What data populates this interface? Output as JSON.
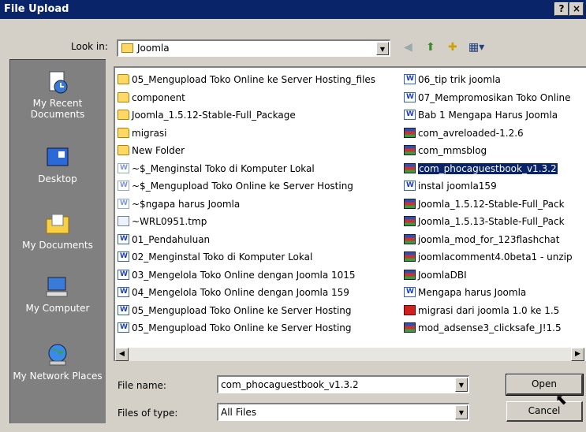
{
  "window": {
    "title": "File Upload",
    "help": "?",
    "close": "×"
  },
  "lookin": {
    "label": "Look in:",
    "value": "Joomla"
  },
  "toolbar": {
    "back": "back-icon",
    "up": "up-folder-icon",
    "new_folder": "new-folder-icon",
    "views": "views-menu-icon"
  },
  "places": [
    {
      "label": "My Recent Documents",
      "icon": "recent-documents-icon"
    },
    {
      "label": "Desktop",
      "icon": "desktop-icon"
    },
    {
      "label": "My Documents",
      "icon": "my-documents-icon"
    },
    {
      "label": "My Computer",
      "icon": "my-computer-icon"
    },
    {
      "label": "My Network Places",
      "icon": "network-places-icon"
    }
  ],
  "files_col1": [
    {
      "name": "05_Mengupload Toko Online ke Server Hosting_files",
      "type": "folder"
    },
    {
      "name": "component",
      "type": "folder"
    },
    {
      "name": "Joomla_1.5.12-Stable-Full_Package",
      "type": "folder"
    },
    {
      "name": "migrasi",
      "type": "folder"
    },
    {
      "name": "New Folder",
      "type": "folder"
    },
    {
      "name": "~$_Menginstal Toko di Komputer Lokal",
      "type": "doc-faded"
    },
    {
      "name": "~$_Mengupload Toko Online ke Server Hosting",
      "type": "doc-faded"
    },
    {
      "name": "~$ngapa harus Joomla",
      "type": "doc-faded"
    },
    {
      "name": "~WRL0951.tmp",
      "type": "tmp"
    },
    {
      "name": "01_Pendahuluan",
      "type": "doc"
    },
    {
      "name": "02_Menginstal Toko di Komputer Lokal",
      "type": "doc"
    },
    {
      "name": "03_Mengelola Toko Online dengan Joomla 1015",
      "type": "doc"
    },
    {
      "name": "04_Mengelola Toko Online dengan Joomla 159",
      "type": "doc"
    },
    {
      "name": "05_Mengupload Toko Online ke Server Hosting",
      "type": "doc"
    },
    {
      "name": "05_Mengupload Toko Online ke Server Hosting",
      "type": "doc"
    }
  ],
  "files_col2": [
    {
      "name": "06_tip trik joomla",
      "type": "doc"
    },
    {
      "name": "07_Mempromosikan Toko Online",
      "type": "doc"
    },
    {
      "name": "Bab 1 Mengapa Harus Joomla",
      "type": "doc"
    },
    {
      "name": "com_avreloaded-1.2.6",
      "type": "rar"
    },
    {
      "name": "com_mmsblog",
      "type": "rar"
    },
    {
      "name": "com_phocaguestbook_v1.3.2",
      "type": "rar",
      "selected": true
    },
    {
      "name": "instal joomla159",
      "type": "doc"
    },
    {
      "name": "Joomla_1.5.12-Stable-Full_Pack",
      "type": "rar"
    },
    {
      "name": "Joomla_1.5.13-Stable-Full_Pack",
      "type": "rar"
    },
    {
      "name": "joomla_mod_for_123flashchat",
      "type": "rar"
    },
    {
      "name": "joomlacomment4.0beta1 - unzip",
      "type": "rar"
    },
    {
      "name": "JoomlaDBI",
      "type": "rar"
    },
    {
      "name": "Mengapa harus Joomla",
      "type": "doc"
    },
    {
      "name": "migrasi dari joomla 1.0 ke 1.5",
      "type": "pdf"
    },
    {
      "name": "mod_adsense3_clicksafe_J!1.5",
      "type": "rar"
    }
  ],
  "filename": {
    "label": "File name:",
    "value": "com_phocaguestbook_v1.3.2"
  },
  "filetype": {
    "label": "Files of type:",
    "value": "All Files"
  },
  "buttons": {
    "open": "Open",
    "cancel": "Cancel"
  }
}
